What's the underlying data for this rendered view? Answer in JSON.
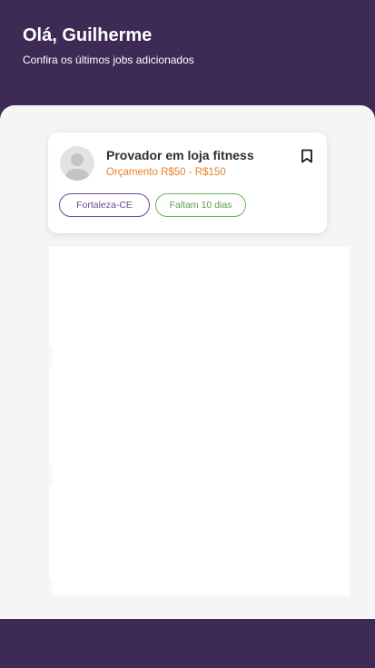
{
  "header": {
    "greeting": "Olá, Guilherme",
    "subtitle": "Confira os últimos jobs adicionados"
  },
  "jobs": [
    {
      "title": "Provador em loja fitness",
      "budget": "Orçamento R$50 - R$150",
      "location": "Fortaleza-CE",
      "deadline": "Faltam 10 dias",
      "avatar_icon": "user-avatar-icon",
      "bookmark_icon": "bookmark-icon"
    }
  ],
  "colors": {
    "primary": "#3d2a55",
    "background": "#f5f5f5",
    "budget": "#e8822d",
    "location_tag": "#6b4a94",
    "deadline_tag": "#5a9a48"
  }
}
